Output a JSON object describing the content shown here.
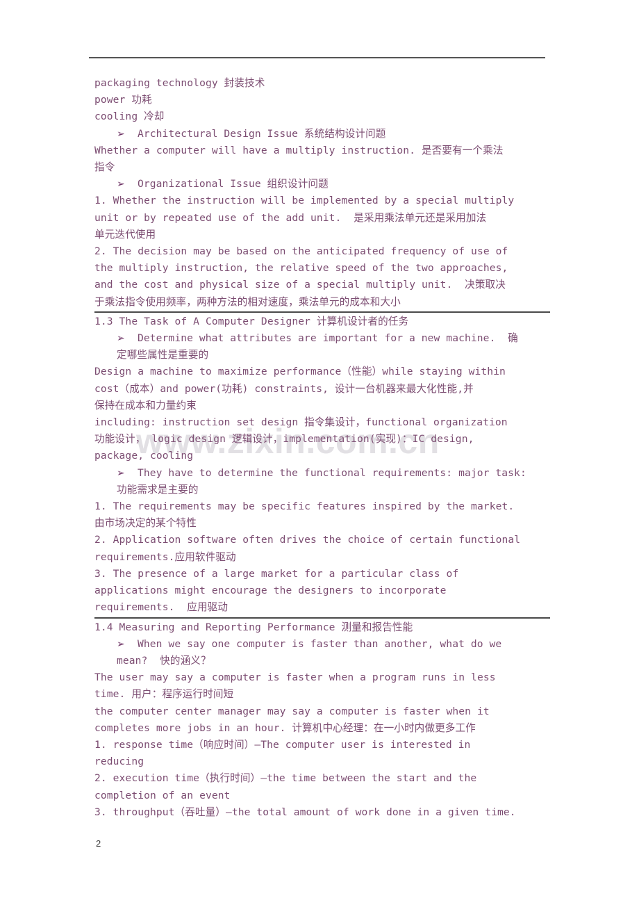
{
  "page": {
    "number": "2",
    "text_color": "#7c4d72",
    "rule_color": "#4a4a4a",
    "watermark_color": "#e2e0e4"
  },
  "watermark": {
    "text": "www.zixin.com.cn"
  },
  "bullet": {
    "glyph": "➢"
  },
  "content": {
    "lines": [
      {
        "kind": "plain",
        "text": "packaging technology 封装技术"
      },
      {
        "kind": "plain",
        "text": "power 功耗"
      },
      {
        "kind": "plain",
        "text": "cooling 冷却"
      },
      {
        "kind": "bullet",
        "text": "Architectural Design Issue 系统结构设计问题"
      },
      {
        "kind": "plain",
        "text": "Whether a computer will have a multiply instruction. 是否要有一个乘法"
      },
      {
        "kind": "plain",
        "text": "指令"
      },
      {
        "kind": "bullet",
        "text": "Organizational Issue 组织设计问题"
      },
      {
        "kind": "plain",
        "text": "1. Whether the instruction will be implemented by a special multiply"
      },
      {
        "kind": "plain",
        "text": "unit or by repeated use of the add unit.  是采用乘法单元还是采用加法"
      },
      {
        "kind": "plain",
        "text": "单元迭代使用"
      },
      {
        "kind": "plain",
        "text": "2. The decision may be based on the anticipated frequency of use of"
      },
      {
        "kind": "plain",
        "text": "the multiply instruction, the relative speed of the two approaches,"
      },
      {
        "kind": "plain",
        "text": "and the cost and physical size of a special multiply unit.  决策取决"
      },
      {
        "kind": "plain",
        "text": "于乘法指令使用频率，两种方法的相对速度，乘法单元的成本和大小"
      },
      {
        "kind": "rule",
        "text": ""
      },
      {
        "kind": "plain",
        "text": "1.3 The Task of A Computer Designer 计算机设计者的任务"
      },
      {
        "kind": "bullet",
        "text": "Determine what attributes are important for a new machine.  确"
      },
      {
        "kind": "cont",
        "text": "定哪些属性是重要的"
      },
      {
        "kind": "plain",
        "text": "Design a machine to maximize performance（性能）while staying within"
      },
      {
        "kind": "plain",
        "text": "cost（成本）and power(功耗) constraints, 设计一台机器来最大化性能,并"
      },
      {
        "kind": "plain",
        "text": "保持在成本和力量约束"
      },
      {
        "kind": "plain",
        "text": "including: instruction set design 指令集设计，functional organization"
      },
      {
        "kind": "plain",
        "text": "功能设计， logic design 逻辑设计，implementation(实现)：IC design,"
      },
      {
        "kind": "plain",
        "text": "package, cooling"
      },
      {
        "kind": "bullet",
        "text": "They have to determine the functional requirements: major task:"
      },
      {
        "kind": "cont",
        "text": "功能需求是主要的"
      },
      {
        "kind": "plain",
        "text": "1. The requirements may be specific features inspired by the market."
      },
      {
        "kind": "plain",
        "text": "由市场决定的某个特性"
      },
      {
        "kind": "plain",
        "text": "2. Application software often drives the choice of certain functional"
      },
      {
        "kind": "plain",
        "text": "requirements.应用软件驱动"
      },
      {
        "kind": "plain",
        "text": "3. The presence of a large market for a particular class of"
      },
      {
        "kind": "plain",
        "text": "applications might encourage the designers to incorporate"
      },
      {
        "kind": "plain",
        "text": "requirements.  应用驱动"
      },
      {
        "kind": "rule",
        "text": ""
      },
      {
        "kind": "plain",
        "text": "1.4 Measuring and Reporting Performance 测量和报告性能"
      },
      {
        "kind": "bullet",
        "text": "When we say one computer is faster than another, what do we"
      },
      {
        "kind": "cont",
        "text": "mean?  快的涵义？"
      },
      {
        "kind": "plain",
        "text": "The user may say a computer is faster when a program runs in less"
      },
      {
        "kind": "plain",
        "text": "time. 用户：程序运行时间短"
      },
      {
        "kind": "plain",
        "text": "the computer center manager may say a computer is faster when it"
      },
      {
        "kind": "plain",
        "text": "completes more jobs in an hour. 计算机中心经理：在一小时内做更多工作"
      },
      {
        "kind": "plain",
        "text": "1. response time（响应时间）—The computer user is interested in"
      },
      {
        "kind": "plain",
        "text": "reducing"
      },
      {
        "kind": "plain",
        "text": "2. execution time（执行时间）—the time between the start and the"
      },
      {
        "kind": "plain",
        "text": "completion of an event"
      },
      {
        "kind": "plain",
        "text": "3. throughput（吞吐量）—the total amount of work done in a given time."
      }
    ]
  }
}
